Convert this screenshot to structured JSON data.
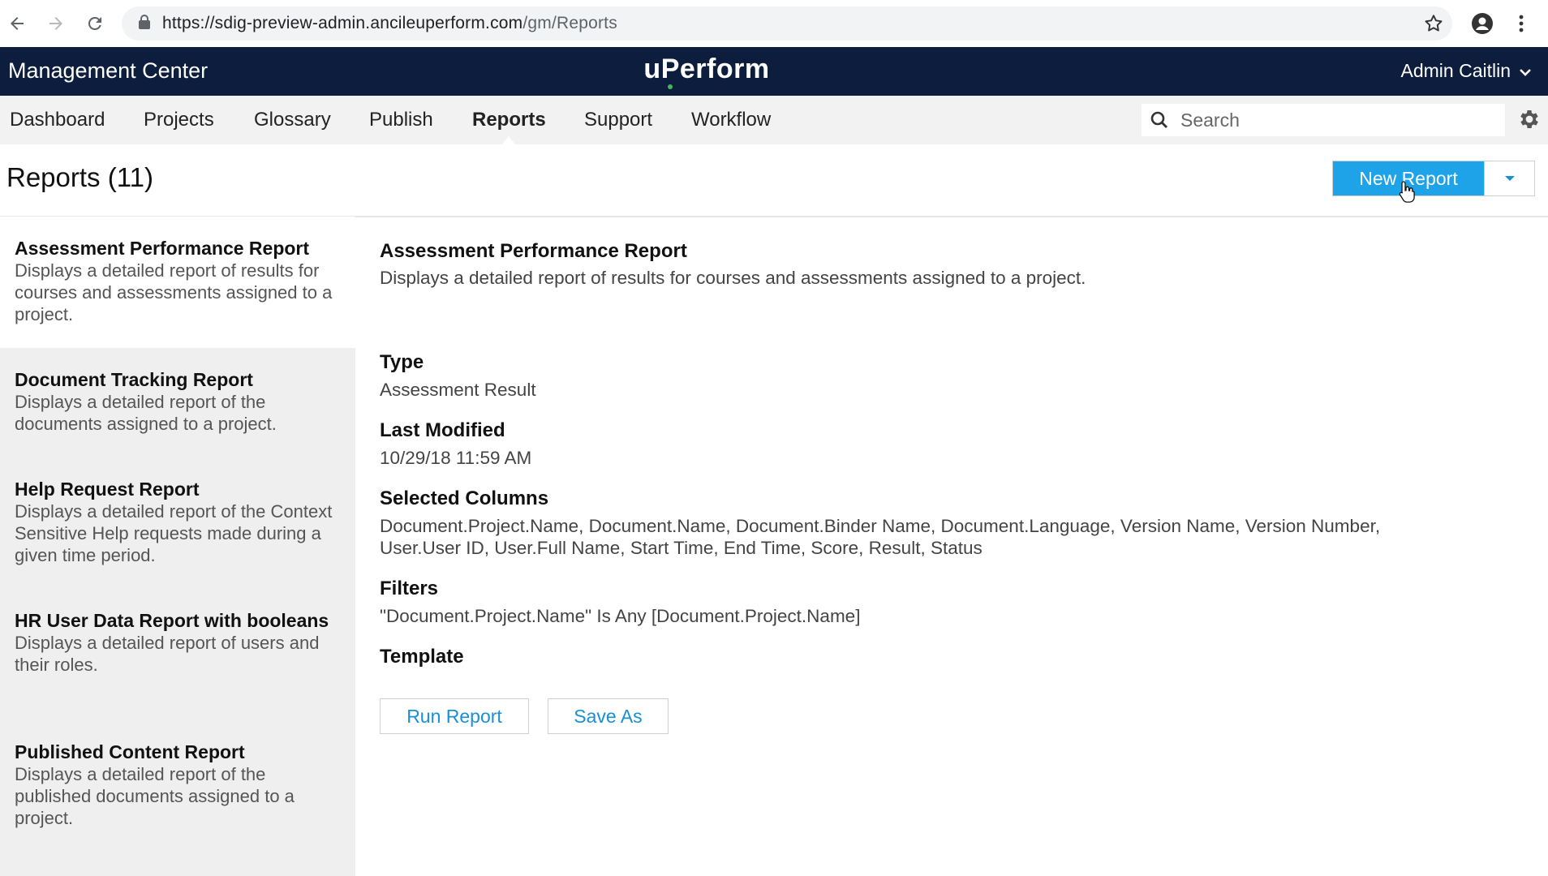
{
  "browser": {
    "url_main": "https://sdig-preview-admin.ancileuperform.com",
    "url_path": "/gm/Reports"
  },
  "header": {
    "app_title": "Management Center",
    "logo": {
      "part1": "u",
      "part2": "P",
      "part3": "erform"
    },
    "user_name": "Admin Caitlin"
  },
  "nav": {
    "items": [
      {
        "label": "Dashboard"
      },
      {
        "label": "Projects"
      },
      {
        "label": "Glossary"
      },
      {
        "label": "Publish"
      },
      {
        "label": "Reports",
        "active": true
      },
      {
        "label": "Support"
      },
      {
        "label": "Workflow"
      }
    ],
    "search_placeholder": "Search"
  },
  "page": {
    "title": "Reports (11)",
    "new_report_label": "New Report"
  },
  "sidebar": {
    "reports": [
      {
        "title": "Assessment Performance Report",
        "desc": "Displays a detailed report of results for courses and assessments assigned to a project."
      },
      {
        "title": "Document Tracking Report",
        "desc": "Displays a detailed report of the documents assigned to a project."
      },
      {
        "title": "Help Request Report",
        "desc": "Displays a detailed report of the Context Sensitive Help requests made during a given time period."
      },
      {
        "title": "HR User Data Report with booleans",
        "desc": "Displays a detailed report of users and their roles."
      },
      {
        "title": "Published Content Report",
        "desc": "Displays a detailed report of the published documents assigned to a project."
      }
    ]
  },
  "detail": {
    "title": "Assessment Performance Report",
    "description": "Displays a detailed report of results for courses and assessments assigned to a project.",
    "type_label": "Type",
    "type_value": "Assessment Result",
    "modified_label": "Last Modified",
    "modified_value": "10/29/18 11:59 AM",
    "columns_label": "Selected Columns",
    "columns_value": "Document.Project.Name, Document.Name, Document.Binder Name, Document.Language, Version Name, Version Number, User.User ID, User.Full Name, Start Time, End Time, Score, Result, Status",
    "filters_label": "Filters",
    "filters_value": "\"Document.Project.Name\" Is Any [Document.Project.Name]",
    "template_label": "Template",
    "run_label": "Run Report",
    "save_as_label": "Save As"
  },
  "colors": {
    "header_bg": "#0d1d3d",
    "accent_blue": "#1fa3e8",
    "link_blue": "#1a8fd6",
    "logo_dot": "#3dbb5c"
  }
}
